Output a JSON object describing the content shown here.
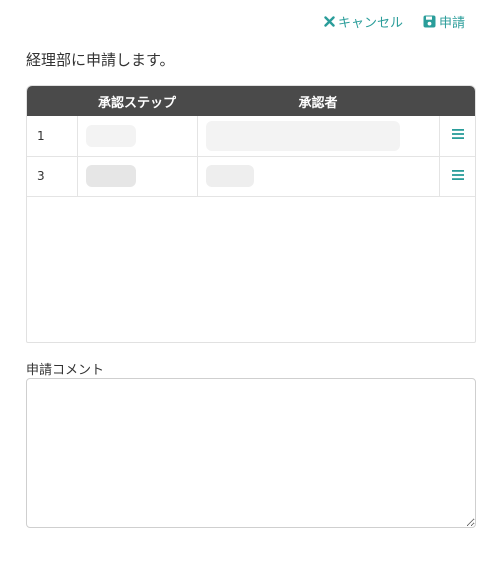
{
  "toolbar": {
    "cancel_label": "キャンセル",
    "submit_label": "申請"
  },
  "message": "経理部に申請します。",
  "approval_table": {
    "headers": [
      "",
      "承認ステップ",
      "承認者",
      ""
    ],
    "rows": [
      {
        "index": "1"
      },
      {
        "index": "3"
      }
    ]
  },
  "comment": {
    "label": "申請コメント",
    "value": ""
  },
  "colors": {
    "accent": "#2a9d9a",
    "header_bg": "#4a4a4a"
  },
  "icons": {
    "cancel": "close-icon",
    "submit": "save-icon",
    "row_menu": "hamburger-icon"
  }
}
